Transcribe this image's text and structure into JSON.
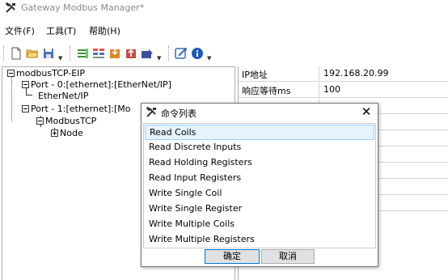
{
  "window": {
    "title": "Gateway Modbus Manager*"
  },
  "menu": [
    "文件(F)",
    "工具(T)",
    "帮助(H)"
  ],
  "toolbar": {
    "icons": [
      "new-file-icon",
      "open-folder-icon",
      "save-icon",
      "add-port-icon",
      "add-device-icon",
      "import-icon",
      "export-icon",
      "write-device-icon",
      "connect-icon",
      "info-icon"
    ]
  },
  "tree": {
    "root": "modbusTCP-EIP",
    "port0": "Port - 0:[ethernet]:[EtherNet/IP]",
    "port0_child": "EtherNet/IP",
    "port1": "Port - 1:[ethernet]:[Mo",
    "port1_child": "ModbusTCP",
    "node": "Node"
  },
  "properties": {
    "rows": [
      {
        "key": "IP地址",
        "value": "192.168.20.99"
      },
      {
        "key": "响应等待ms",
        "value": "100"
      }
    ]
  },
  "dialog": {
    "title": "命令列表",
    "items": [
      "Read Coils",
      "Read Discrete Inputs",
      "Read Holding Registers",
      "Read Input Registers",
      "Write Single Coil",
      "Write Single Register",
      "Write Multiple Coils",
      "Write Multiple Registers"
    ],
    "selected_index": 0,
    "ok_label": "确定",
    "cancel_label": "取消"
  }
}
